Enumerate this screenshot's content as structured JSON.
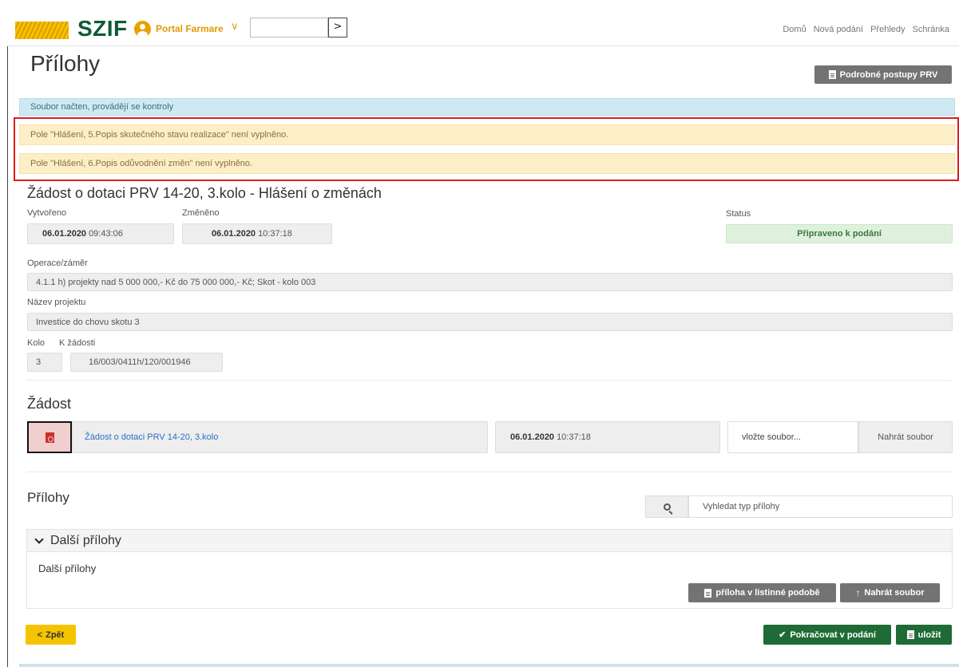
{
  "header": {
    "logo": "SZIF",
    "portal_label": "Portal Farmare",
    "portal_chevron": "∨",
    "search_go": ">",
    "nav": [
      "Domů",
      "Nová podání",
      "Přehledy",
      "Schránka"
    ]
  },
  "page": {
    "title": "Přílohy",
    "procedures_button": "Podrobné postupy PRV"
  },
  "alerts": {
    "info": "Soubor načten, provádějí se kontroly",
    "warnings": [
      "Pole \"Hlášení, 5.Popis skutečného stavu realizace\" není vyplněno.",
      "Pole \"Hlášení, 6.Popis odůvodnění změn\" není vyplněno."
    ]
  },
  "application": {
    "title": "Žádost o dotaci PRV 14-20, 3.kolo - Hlášení o změnách",
    "created_label": "Vytvořeno",
    "created_date": "06.01.2020",
    "created_time": "09:43:06",
    "changed_label": "Změněno",
    "changed_date": "06.01.2020",
    "changed_time": "10:37:18",
    "status_label": "Status",
    "status_value": "Připraveno k podání",
    "operation_label": "Operace/záměr",
    "operation_value": "4.1.1 h) projekty nad 5 000 000,- Kč do 75 000 000,- Kč; Skot - kolo 003",
    "project_label": "Název projektu",
    "project_value": "Investice do chovu skotu 3",
    "round_label": "Kolo",
    "round_value": "3",
    "ref_label": "K žádosti",
    "ref_value": "16/003/0411h/120/001946"
  },
  "request": {
    "title": "Žádost",
    "file_link": "Žádost o dotaci PRV 14-20, 3.kolo",
    "file_date": "06.01.2020",
    "file_time": "10:37:18",
    "upload_placeholder": "vložte soubor...",
    "upload_button": "Nahrát soubor"
  },
  "attachments": {
    "title": "Přílohy",
    "search_placeholder": "Vyhledat typ přílohy",
    "panel_title": "Další přílohy",
    "panel_subtitle": "Další přílohy",
    "paper_button": "příloha v listinné podobě",
    "upload_button": "Nahrát soubor"
  },
  "footer": {
    "back": "Zpět",
    "back_chevron": "<",
    "continue": "Pokračovat v podání",
    "continue_check": "✔",
    "save": "uložit",
    "upload_arrow": "↑"
  },
  "colors": {
    "brand_green": "#0f5a36",
    "accent_yellow": "#f5c400",
    "action_green": "#1f6b35",
    "warning_bg": "#fcefc8",
    "info_bg": "#cfe9f2",
    "highlight_red": "#dd1d1d"
  }
}
